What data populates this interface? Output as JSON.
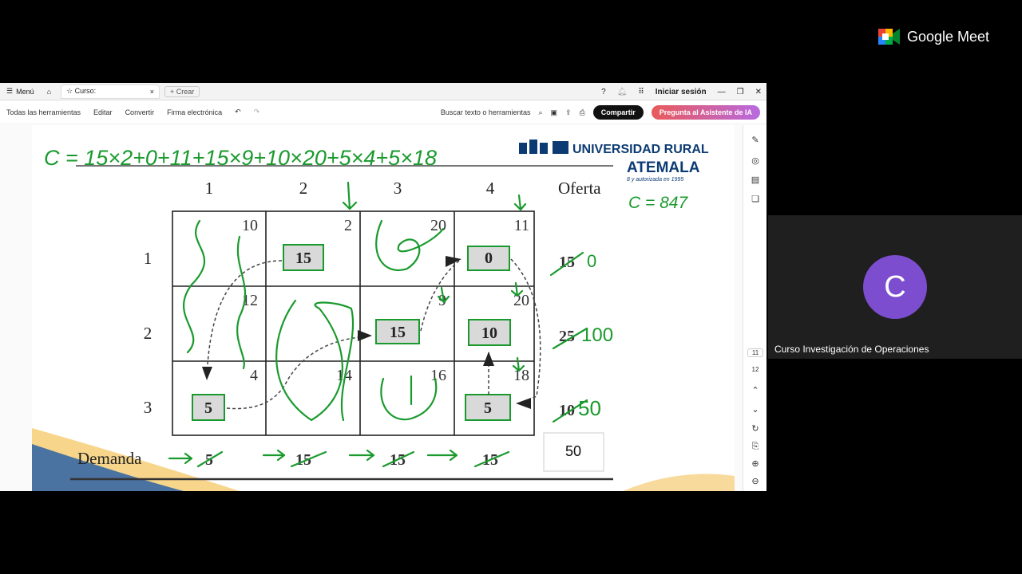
{
  "meet": {
    "brand": "Google Meet",
    "participant_initial": "C",
    "participant_name": "Curso Investigación de Operaciones"
  },
  "browser": {
    "menu": "Menú",
    "tab_title": "Curso:",
    "new_tab": "Crear",
    "signin": "Iniciar sesión"
  },
  "toolbar": {
    "all_tools": "Todas las herramientas",
    "edit": "Editar",
    "convert": "Convertir",
    "sign": "Firma electrónica",
    "search": "Buscar texto o herramientas",
    "share": "Compartir",
    "ai": "Pregunta al Asistente de IA"
  },
  "pages": {
    "p1": "11",
    "p2": "12"
  },
  "doc": {
    "university_line1": "UNIVERSIDAD RURAL",
    "university_line2": "ATEMALA",
    "university_line3": "8 y autorizada en 1995",
    "formula": "C = 15×2+0+11+15×9+10×20+5×4+5×18",
    "total": "C = 847",
    "col_headers": [
      "1",
      "2",
      "3",
      "4"
    ],
    "oferta_label": "Oferta",
    "demanda_label": "Demanda",
    "row_headers": [
      "1",
      "2",
      "3"
    ],
    "costs": [
      [
        "10",
        "2",
        "20",
        "11"
      ],
      [
        "12",
        "9",
        "20"
      ],
      [
        "4",
        "14",
        "16",
        "18"
      ]
    ],
    "alloc": {
      "r1c2": "15",
      "r1c4": "0",
      "r2c3": "15",
      "r2c4": "10",
      "r3c1": "5",
      "r3c4": "5"
    },
    "supply": [
      "15",
      "25",
      "10"
    ],
    "supply_hand": [
      "0",
      "100",
      "50"
    ],
    "demand": [
      "5",
      "15",
      "15",
      "15"
    ],
    "total_box": "50"
  }
}
